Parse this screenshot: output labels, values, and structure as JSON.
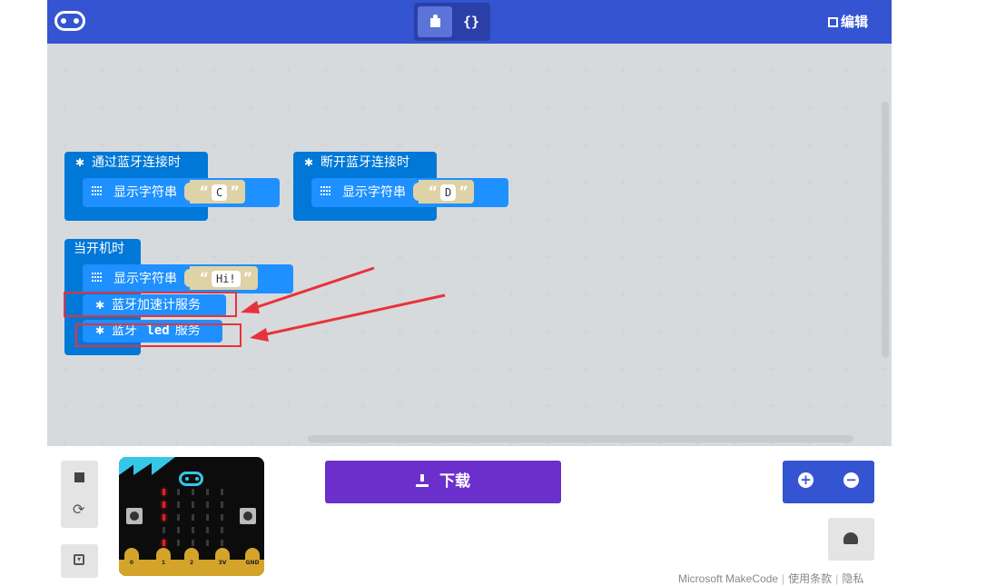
{
  "topbar": {
    "logo_icon": "microbit-logo-icon",
    "blocks_icon": "puzzle-icon",
    "js_label": "{}",
    "edit_label": "编辑",
    "accent": "#3454d1"
  },
  "blocks": {
    "on_connected": {
      "hat": "通过蓝牙连接时",
      "stmt": "显示字符串",
      "value": "C"
    },
    "on_disconnected": {
      "hat": "断开蓝牙连接时",
      "stmt": "显示字符串",
      "value": "D"
    },
    "on_start": {
      "hat": "当开机时",
      "stmt1": "显示字符串",
      "value1": "Hi!",
      "stmt2": "蓝牙加速计服务",
      "stmt3_a": "蓝牙",
      "stmt3_b": "led",
      "stmt3_c": "服务"
    },
    "block_color": "#0078d7",
    "string_color": "#ded2a7",
    "quote_open": "“",
    "quote_close": "”"
  },
  "simulator": {
    "stop_icon": "stop-icon",
    "restart_icon": "⟳",
    "small_icon": "▾",
    "pins": [
      "0",
      "1",
      "2",
      "3V",
      "GND"
    ]
  },
  "download": {
    "label": "下载",
    "color": "#6b2fcc"
  },
  "zoom": {
    "in_label": "+",
    "out_label": "−"
  },
  "footer": {
    "brand": "Microsoft MakeCode",
    "terms": "使用条款",
    "privacy": "隐私"
  }
}
